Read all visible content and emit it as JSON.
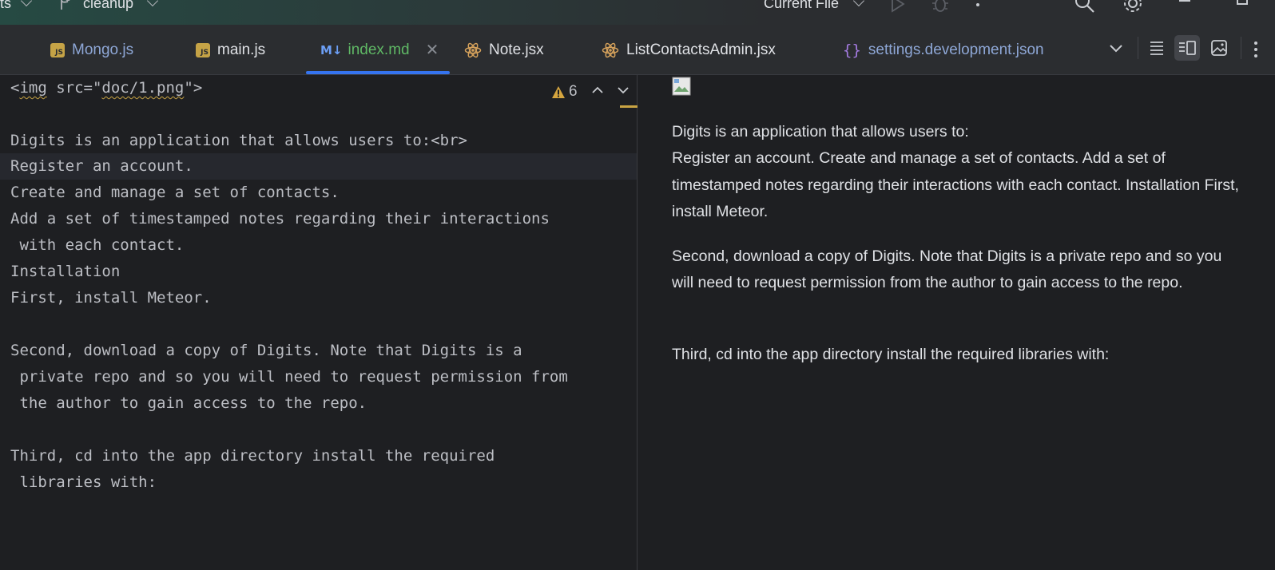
{
  "titlebar": {
    "project_fragment": "ts",
    "branch": "cleanup",
    "run_config": "Current File"
  },
  "tabs": [
    {
      "label": "Mongo.js",
      "type": "js",
      "color": "#8ea7d6"
    },
    {
      "label": "main.js",
      "type": "js",
      "color": "#dfe1e5"
    },
    {
      "label": "index.md",
      "type": "md",
      "color": "#5fb865",
      "active": true
    },
    {
      "label": "Note.jsx",
      "type": "react",
      "color": "#dfe1e5"
    },
    {
      "label": "ListContactsAdmin.jsx",
      "type": "react",
      "color": "#dfe1e5"
    },
    {
      "label": "settings.development.json",
      "type": "json",
      "color": "#8ea7d6"
    }
  ],
  "icons": {
    "js": "javascript-file-icon",
    "md": "markdown-file-icon",
    "react": "react-file-icon",
    "json": "json-file-icon"
  },
  "editor": {
    "warning_count": "6",
    "lines": [
      {
        "pre": "<",
        "squig1": "img",
        "mid": " src=\"",
        "squig2": "doc/1.png",
        "post": "\">"
      },
      "",
      "Digits is an application that allows users to:<br>",
      "Register an account.",
      "Create and manage a set of contacts.",
      "Add a set of timestamped notes regarding their interactions",
      " with each contact.",
      "Installation",
      "First, install Meteor.",
      "",
      "Second, download a copy of Digits. Note that Digits is a",
      " private repo and so you will need to request permission from",
      " the author to gain access to the repo.",
      "",
      "Third, cd into the app directory install the required",
      " libraries with:"
    ]
  },
  "preview": {
    "p1_line1": "Digits is an application that allows users to:",
    "p1_rest": "Register an account. Create and manage a set of contacts. Add a set of timestamped notes regarding their interactions with each contact. Installation First, install Meteor.",
    "p2": "Second, download a copy of Digits. Note that Digits is a private repo and so you will need to request permission from the author to gain access to the repo.",
    "p3": "Third, cd into the app directory install the required libraries with:"
  }
}
